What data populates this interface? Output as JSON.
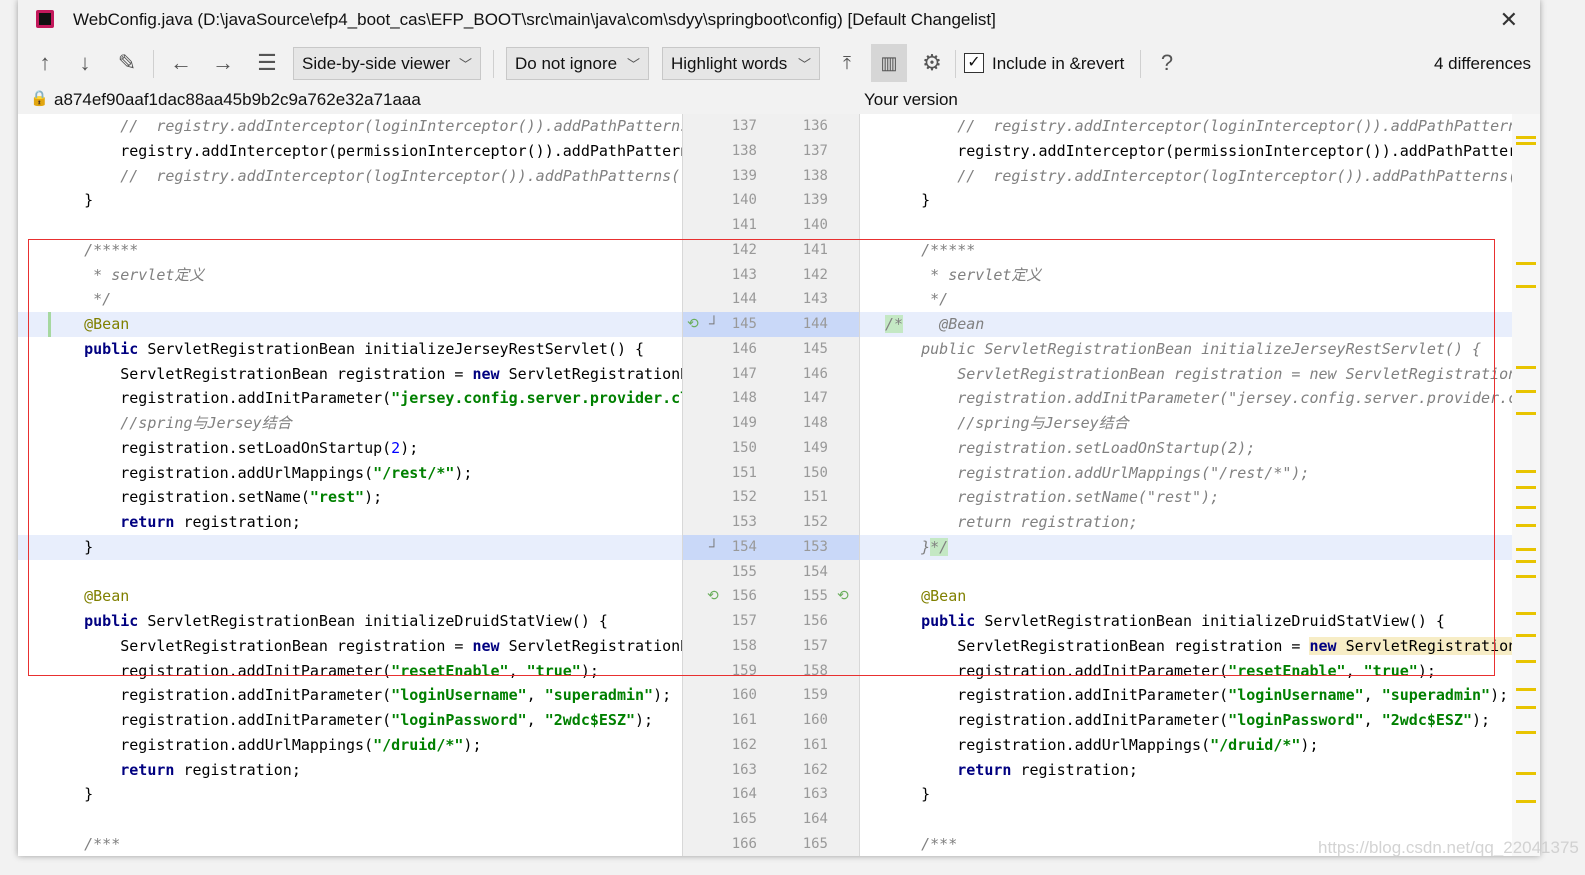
{
  "window": {
    "title": "WebConfig.java (D:\\javaSource\\efp4_boot_cas\\EFP_BOOT\\src\\main\\java\\com\\sdyy\\springboot\\config) [Default Changelist]"
  },
  "toolbar": {
    "viewer": "Side-by-side viewer",
    "ignore": "Do not ignore",
    "highlight": "Highlight words",
    "include_label": "Include in &revert",
    "include_checked": true,
    "help": "?",
    "differences": "4 differences"
  },
  "left": {
    "revision": "a874ef90aaf1dac88aa45b9b2c9a762e32a71aaa"
  },
  "right": {
    "label": "Your version"
  },
  "colors": {
    "accent_highlight": "#e8eefc",
    "inserted": "#c4e8c4",
    "changed": "#f7edc6",
    "marker": "#e8c400"
  },
  "highlighted_rows": [
    8,
    17
  ],
  "gutter": {
    "left": [
      "137",
      "138",
      "139",
      "140",
      "141",
      "142",
      "143",
      "144",
      "145",
      "146",
      "147",
      "148",
      "149",
      "150",
      "151",
      "152",
      "153",
      "154",
      "155",
      "156",
      "157",
      "158",
      "159",
      "160",
      "161",
      "162",
      "163",
      "164",
      "165",
      "166"
    ],
    "right": [
      "136",
      "137",
      "138",
      "139",
      "140",
      "141",
      "142",
      "143",
      "144",
      "145",
      "146",
      "147",
      "148",
      "149",
      "150",
      "151",
      "152",
      "153",
      "154",
      "155",
      "156",
      "157",
      "158",
      "159",
      "160",
      "161",
      "162",
      "163",
      "164",
      "165"
    ]
  },
  "left_lines": [
    [
      [
        "t",
        "        "
      ],
      [
        "c",
        "//  registry.addInterceptor(loginInterceptor()).addPathPatterns(\"/**\")"
      ]
    ],
    [
      [
        "t",
        "        registry.addInterceptor(permissionInterceptor()).addPathPatterns(\"/**\")"
      ]
    ],
    [
      [
        "t",
        "        "
      ],
      [
        "c",
        "//  registry.addInterceptor(logInterceptor()).addPathPatterns(\"/**\")"
      ]
    ],
    [
      [
        "t",
        "    }"
      ]
    ],
    [],
    [
      [
        "c",
        "    /*****"
      ]
    ],
    [
      [
        "c",
        "     * servlet定义"
      ]
    ],
    [
      [
        "c",
        "     */"
      ]
    ],
    [
      [
        "a",
        "    @Bean"
      ]
    ],
    [
      [
        "t",
        "    "
      ],
      [
        "k",
        "public"
      ],
      [
        "t",
        " ServletRegistrationBean initializeJerseyRestServlet() {"
      ]
    ],
    [
      [
        "t",
        "        ServletRegistrationBean registration = "
      ],
      [
        "k",
        "new"
      ],
      [
        "t",
        " ServletRegistrationBean("
      ]
    ],
    [
      [
        "t",
        "        registration.addInitParameter("
      ],
      [
        "s",
        "\"jersey.config.server.provider.classnames\""
      ]
    ],
    [
      [
        "t",
        "        "
      ],
      [
        "c",
        "//spring与Jersey结合"
      ]
    ],
    [
      [
        "t",
        "        registration.setLoadOnStartup("
      ],
      [
        "n",
        "2"
      ],
      [
        "t",
        ");"
      ]
    ],
    [
      [
        "t",
        "        registration.addUrlMappings("
      ],
      [
        "s",
        "\"/rest/*\""
      ],
      [
        "t",
        ");"
      ]
    ],
    [
      [
        "t",
        "        registration.setName("
      ],
      [
        "s",
        "\"rest\""
      ],
      [
        "t",
        ");"
      ]
    ],
    [
      [
        "t",
        "        "
      ],
      [
        "k",
        "return"
      ],
      [
        "t",
        " registration;"
      ]
    ],
    [
      [
        "t",
        "    }"
      ]
    ],
    [],
    [
      [
        "a",
        "    @Bean"
      ]
    ],
    [
      [
        "t",
        "    "
      ],
      [
        "k",
        "public"
      ],
      [
        "t",
        " ServletRegistrationBean initializeDruidStatView() {"
      ]
    ],
    [
      [
        "t",
        "        ServletRegistrationBean registration = "
      ],
      [
        "k",
        "new"
      ],
      [
        "t",
        " ServletRegistrationBean("
      ]
    ],
    [
      [
        "t",
        "        registration.addInitParameter("
      ],
      [
        "s",
        "\"resetEnable\""
      ],
      [
        "t",
        ", "
      ],
      [
        "s",
        "\"true\""
      ],
      [
        "t",
        ");"
      ]
    ],
    [
      [
        "t",
        "        registration.addInitParameter("
      ],
      [
        "s",
        "\"loginUsername\""
      ],
      [
        "t",
        ", "
      ],
      [
        "s",
        "\"superadmin\""
      ],
      [
        "t",
        ");"
      ]
    ],
    [
      [
        "t",
        "        registration.addInitParameter("
      ],
      [
        "s",
        "\"loginPassword\""
      ],
      [
        "t",
        ", "
      ],
      [
        "s",
        "\"2wdc$ESZ\""
      ],
      [
        "t",
        ");"
      ]
    ],
    [
      [
        "t",
        "        registration.addUrlMappings("
      ],
      [
        "s",
        "\"/druid/*\""
      ],
      [
        "t",
        ");"
      ]
    ],
    [
      [
        "t",
        "        "
      ],
      [
        "k",
        "return"
      ],
      [
        "t",
        " registration;"
      ]
    ],
    [
      [
        "t",
        "    }"
      ]
    ],
    [],
    [
      [
        "c",
        "    /***"
      ]
    ]
  ],
  "right_lines": [
    [
      [
        "t",
        "        "
      ],
      [
        "c",
        "//  registry.addInterceptor(loginInterceptor()).addPathPatterns(\"/**\")"
      ]
    ],
    [
      [
        "t",
        "        registry.addInterceptor(permissionInterceptor()).addPathPatterns(\"/**\")"
      ]
    ],
    [
      [
        "t",
        "        "
      ],
      [
        "c",
        "//  registry.addInterceptor(logInterceptor()).addPathPatterns(\"/**\")"
      ]
    ],
    [
      [
        "t",
        "    }"
      ]
    ],
    [],
    [
      [
        "c",
        "    /*****"
      ]
    ],
    [
      [
        "c",
        "     * servlet定义"
      ]
    ],
    [
      [
        "c",
        "     */"
      ]
    ],
    [
      [
        "g",
        "/*"
      ],
      [
        "c",
        "    @Bean"
      ]
    ],
    [
      [
        "c",
        "    public ServletRegistrationBean initializeJerseyRestServlet() {"
      ]
    ],
    [
      [
        "c",
        "        ServletRegistrationBean registration = new ServletRegistrationBean("
      ]
    ],
    [
      [
        "c",
        "        registration.addInitParameter(\"jersey.config.server.provider.classnames\""
      ]
    ],
    [
      [
        "c",
        "        //spring与Jersey结合"
      ]
    ],
    [
      [
        "c",
        "        registration.setLoadOnStartup(2);"
      ]
    ],
    [
      [
        "c",
        "        registration.addUrlMappings(\"/rest/*\");"
      ]
    ],
    [
      [
        "c",
        "        registration.setName(\"rest\");"
      ]
    ],
    [
      [
        "c",
        "        return registration;"
      ]
    ],
    [
      [
        "c",
        "    }"
      ],
      [
        "g",
        "*/"
      ]
    ],
    [],
    [
      [
        "a",
        "    @Bean"
      ]
    ],
    [
      [
        "t",
        "    "
      ],
      [
        "k",
        "public"
      ],
      [
        "t",
        " ServletRegistrationBean initializeDruidStatView() {"
      ]
    ],
    [
      [
        "t",
        "        ServletRegistrationBean registration = "
      ],
      [
        "yk",
        "new"
      ],
      [
        "y",
        " ServletRegistrationBean("
      ]
    ],
    [
      [
        "t",
        "        registration.addInitParameter("
      ],
      [
        "s",
        "\"resetEnable\""
      ],
      [
        "t",
        ", "
      ],
      [
        "s",
        "\"true\""
      ],
      [
        "t",
        ");"
      ]
    ],
    [
      [
        "t",
        "        registration.addInitParameter("
      ],
      [
        "s",
        "\"loginUsername\""
      ],
      [
        "t",
        ", "
      ],
      [
        "s",
        "\"superadmin\""
      ],
      [
        "t",
        ");"
      ]
    ],
    [
      [
        "t",
        "        registration.addInitParameter("
      ],
      [
        "s",
        "\"loginPassword\""
      ],
      [
        "t",
        ", "
      ],
      [
        "s",
        "\"2wdc$ESZ\""
      ],
      [
        "t",
        ");"
      ]
    ],
    [
      [
        "t",
        "        registration.addUrlMappings("
      ],
      [
        "s",
        "\"/druid/*\""
      ],
      [
        "t",
        ");"
      ]
    ],
    [
      [
        "t",
        "        "
      ],
      [
        "k",
        "return"
      ],
      [
        "t",
        " registration;"
      ]
    ],
    [
      [
        "t",
        "    }"
      ]
    ],
    [],
    [
      [
        "c",
        "    /***"
      ]
    ]
  ],
  "watermark": "https://blog.csdn.net/qq_22041375"
}
